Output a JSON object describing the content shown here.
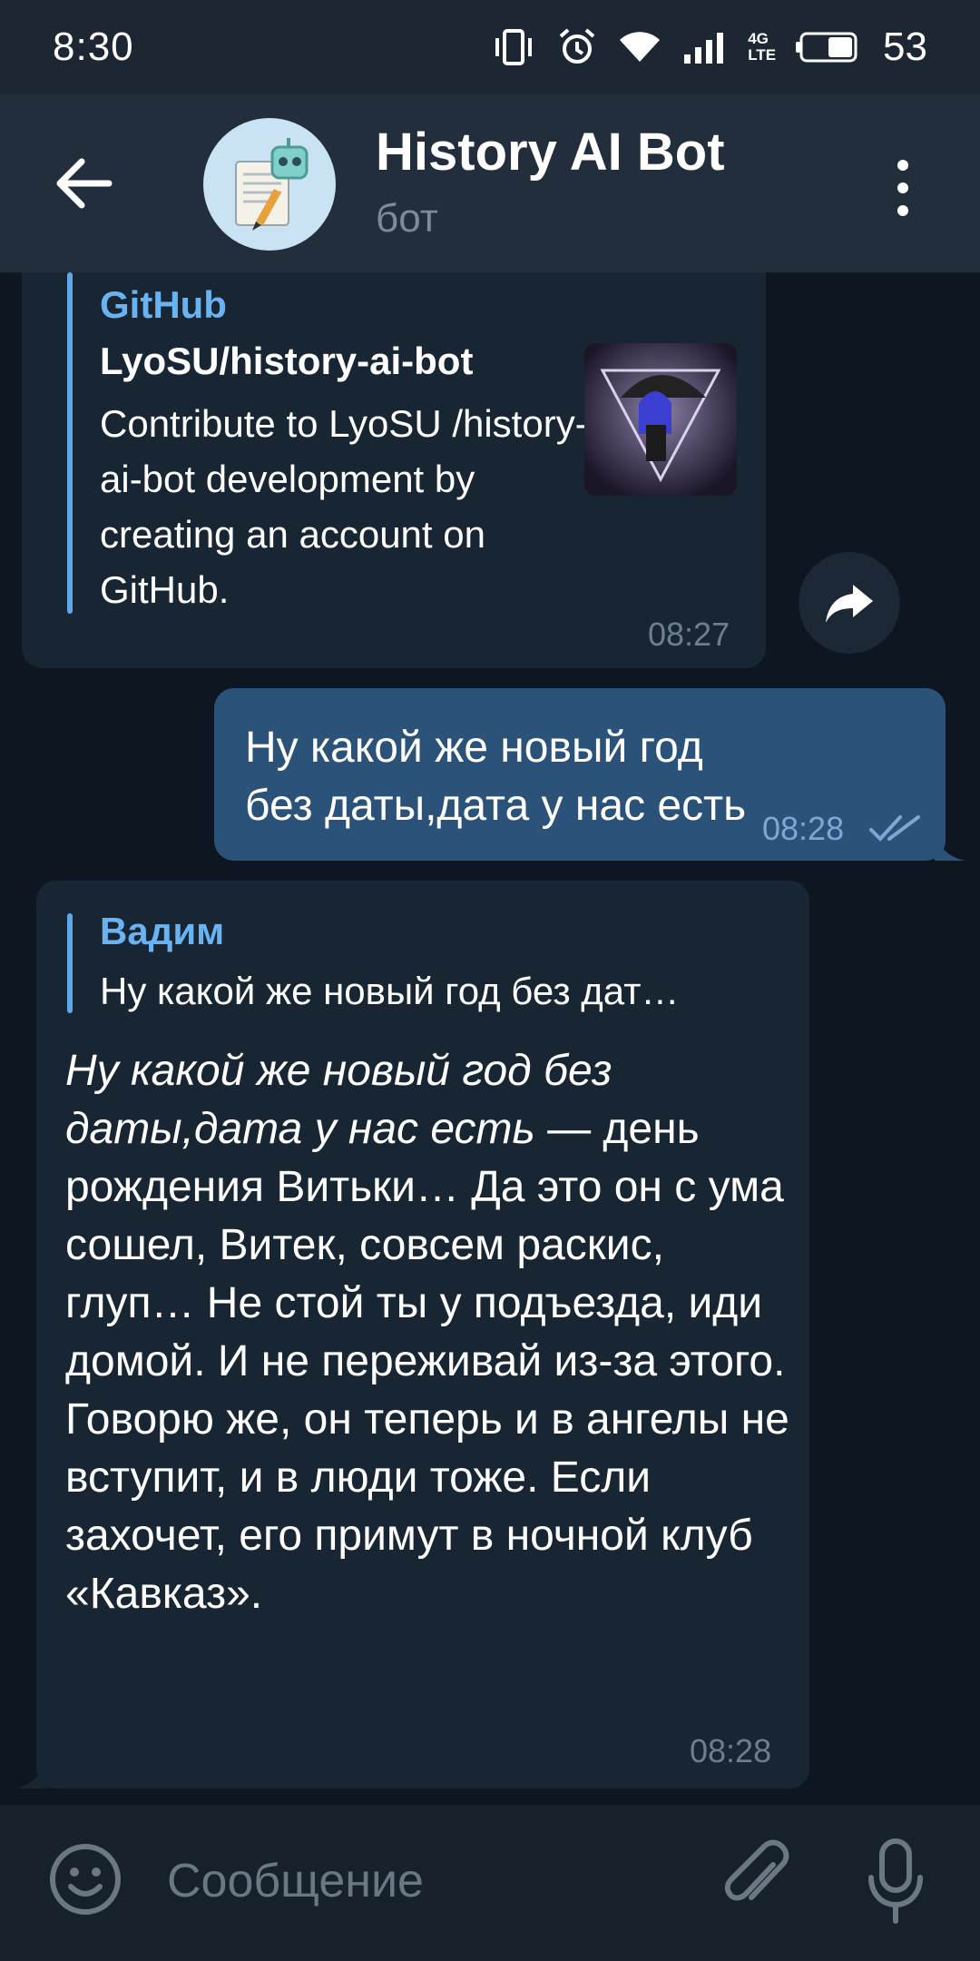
{
  "status_bar": {
    "time": "8:30",
    "network": "4G LTE",
    "battery": "53"
  },
  "header": {
    "title": "History AI Bot",
    "subtitle": "бот"
  },
  "messages": {
    "link_preview": {
      "source": "GitHub",
      "title": "LyoSU/history-ai-bot",
      "description": "Contribute to LyoSU /history-ai-bot development by creating an account on GitHub.",
      "time": "08:27"
    },
    "outgoing": {
      "text": "Ну какой же новый год без даты,дата у нас есть",
      "time": "08:28"
    },
    "reply": {
      "quoted_name": "Вадим",
      "quoted_text": "Ну какой же новый год без дат…",
      "text_italic": "Ну какой же новый год без даты,дата у нас есть",
      "text_rest": " — день рождения Витьки… Да это он с ума сошел, Витек, совсем раскис, глуп… Не стой ты у подъезда, иди домой. И не переживай из-за этого. Говорю же, он теперь и в ангелы не вступит, и в люди тоже. Если захочет, его примут в ночной клуб «Кавказ».",
      "time": "08:28"
    }
  },
  "composer": {
    "placeholder": "Сообщение"
  },
  "colors": {
    "background": "#0e1621",
    "header": "#232e3c",
    "incoming_bubble": "#182533",
    "outgoing_bubble": "#2b5278",
    "accent": "#6ab3f3"
  }
}
